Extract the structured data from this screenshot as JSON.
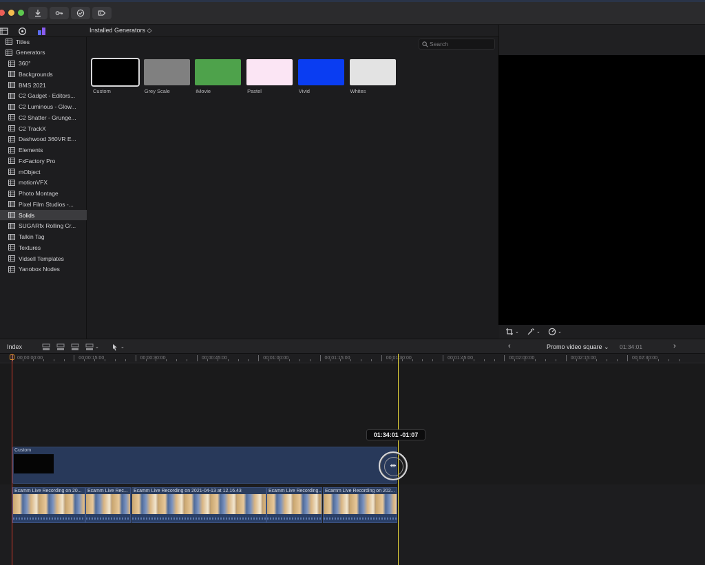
{
  "window": {
    "traffic_colors": [
      "#ed5f57",
      "#f4bd4f",
      "#5dc94f"
    ],
    "toolbar_icons": [
      "download-icon",
      "key-icon",
      "checkmark-circle-icon",
      "tag-icon"
    ]
  },
  "library": {
    "tab_icons": [
      "libraries-icon",
      "photos-icon",
      "titles-generators-icon"
    ],
    "installed_label": "Installed Generators ◇",
    "search_placeholder": "Search",
    "sidebar": [
      {
        "label": "Titles",
        "level": 0,
        "selected": false
      },
      {
        "label": "Generators",
        "level": 0,
        "selected": false
      },
      {
        "label": "360°",
        "level": 1,
        "selected": false
      },
      {
        "label": "Backgrounds",
        "level": 1,
        "selected": false
      },
      {
        "label": "BMS 2021",
        "level": 1,
        "selected": false
      },
      {
        "label": "C2 Gadget - Editors...",
        "level": 1,
        "selected": false
      },
      {
        "label": "C2 Luminous - Glow...",
        "level": 1,
        "selected": false
      },
      {
        "label": "C2 Shatter - Grunge...",
        "level": 1,
        "selected": false
      },
      {
        "label": "C2 TrackX",
        "level": 1,
        "selected": false
      },
      {
        "label": "Dashwood 360VR E...",
        "level": 1,
        "selected": false
      },
      {
        "label": "Elements",
        "level": 1,
        "selected": false
      },
      {
        "label": "FxFactory Pro",
        "level": 1,
        "selected": false
      },
      {
        "label": "mObject",
        "level": 1,
        "selected": false
      },
      {
        "label": "motionVFX",
        "level": 1,
        "selected": false
      },
      {
        "label": "Photo Montage",
        "level": 1,
        "selected": false
      },
      {
        "label": "Pixel Film Studios -...",
        "level": 1,
        "selected": false
      },
      {
        "label": "Solids",
        "level": 1,
        "selected": true
      },
      {
        "label": "SUGARfx Rolling Cr...",
        "level": 1,
        "selected": false
      },
      {
        "label": "Talkin Tag",
        "level": 1,
        "selected": false
      },
      {
        "label": "Textures",
        "level": 1,
        "selected": false
      },
      {
        "label": "Vidsell Templates",
        "level": 1,
        "selected": false
      },
      {
        "label": "Yanobox Nodes",
        "level": 1,
        "selected": false
      }
    ],
    "generators": [
      {
        "label": "Custom",
        "color": "#000000",
        "selected": true
      },
      {
        "label": "Grey Scale",
        "color": "#808080",
        "selected": false
      },
      {
        "label": "iMovie",
        "color": "#4ea24b",
        "selected": false
      },
      {
        "label": "Pastel",
        "color": "#fbe5f4",
        "selected": false
      },
      {
        "label": "Vivid",
        "color": "#0a3df2",
        "selected": false
      },
      {
        "label": "Whites",
        "color": "#e3e3e3",
        "selected": false
      }
    ]
  },
  "viewer": {
    "bottom_icons": [
      "crop-icon",
      "magic-wand-icon",
      "speed-icon"
    ]
  },
  "timeline": {
    "index_label": "Index",
    "project_name": "Promo video square ⌄",
    "project_time": "01:34:01",
    "ruler_labels": [
      "00:00:00:00",
      "00:00:15:00",
      "00:00:30:00",
      "00:00:45:00",
      "00:01:00:00",
      "00:01:15:00",
      "00:01:30:00",
      "00:01:45:00",
      "00:02:00:00",
      "00:02:15:00",
      "00:02:30:00"
    ],
    "tooltip": "01:34:01  -01:07",
    "generator_clip": "Custom",
    "video_clips": [
      "Ecamm Live Recording on 20...",
      "Ecamm Live Rec...",
      "Ecamm Live Recording on 2021-04-13 at 12.16.43",
      "Ecamm Live Recording...",
      "Ecamm Live Recording on 202..."
    ],
    "playhead_color": "#d33a2a",
    "skimmer_color": "#e7d63a"
  }
}
